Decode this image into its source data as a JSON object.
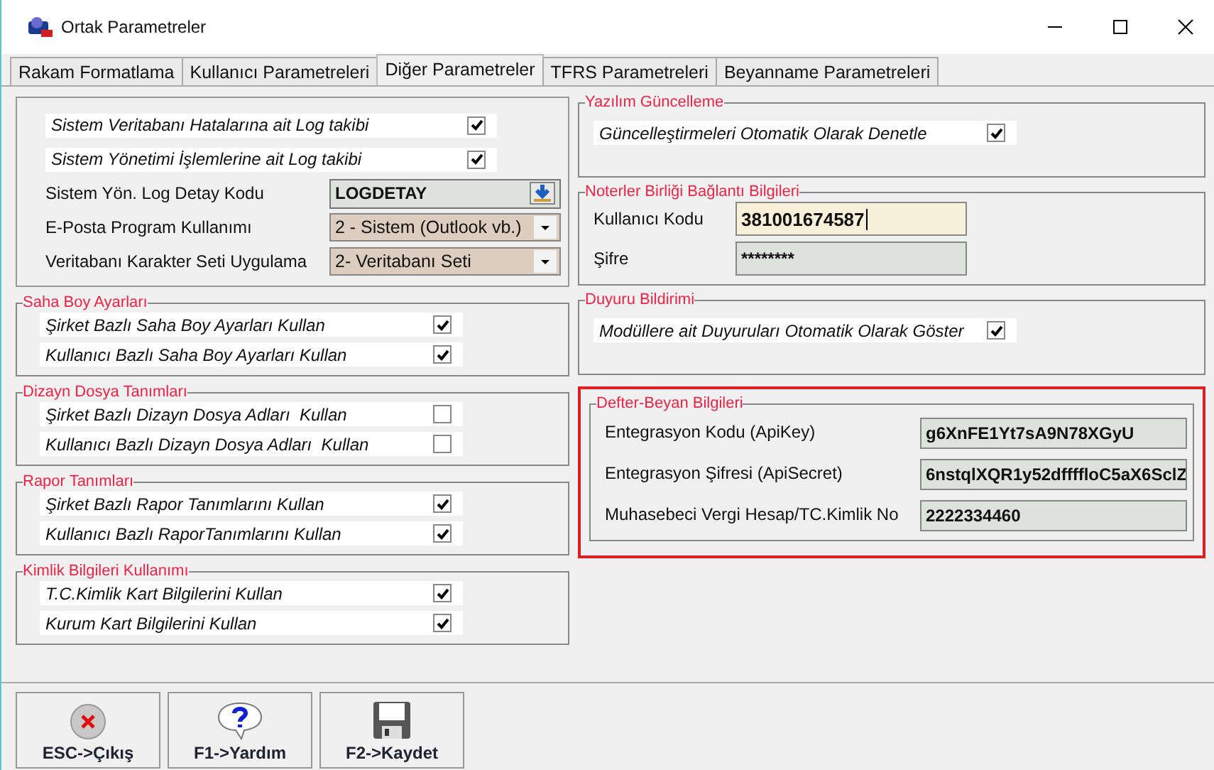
{
  "window": {
    "title": "Ortak Parametreler"
  },
  "tabs": [
    {
      "label": "Rakam Formatlama",
      "selected": false
    },
    {
      "label": "Kullanıcı Parametreleri",
      "selected": false
    },
    {
      "label": "Diğer Parametreler",
      "selected": true
    },
    {
      "label": "TFRS Parametreleri",
      "selected": false
    },
    {
      "label": "Beyanname Parametreleri",
      "selected": false
    }
  ],
  "general": [
    {
      "kind": "checkbox",
      "label": "Sistem Veritabanı Hatalarına ait Log takibi",
      "checked": true
    },
    {
      "kind": "checkbox",
      "label": "Sistem Yönetimi İşlemlerine ait Log takibi",
      "checked": true
    },
    {
      "kind": "lookup",
      "label": "Sistem Yön. Log Detay Kodu",
      "value": "LOGDETAY"
    },
    {
      "kind": "dropdown",
      "label": "E-Posta Program Kullanımı",
      "value": "2 - Sistem (Outlook vb.)"
    },
    {
      "kind": "dropdown",
      "label": "Veritabanı Karakter Seti Uygulama",
      "value": "2- Veritabanı Seti"
    }
  ],
  "left_groups": [
    {
      "title": "Saha Boy Ayarları",
      "items": [
        {
          "kind": "checkbox",
          "label": "Şirket Bazlı Saha Boy Ayarları Kullan",
          "checked": true
        },
        {
          "kind": "checkbox",
          "label": "Kullanıcı Bazlı Saha Boy Ayarları Kullan",
          "checked": true
        }
      ]
    },
    {
      "title": "Dizayn Dosya Tanımları",
      "items": [
        {
          "kind": "checkbox",
          "label": "Şirket Bazlı Dizayn Dosya Adları  Kullan",
          "checked": false
        },
        {
          "kind": "checkbox",
          "label": "Kullanıcı Bazlı Dizayn Dosya Adları  Kullan",
          "checked": false
        }
      ]
    },
    {
      "title": "Rapor Tanımları",
      "items": [
        {
          "kind": "checkbox",
          "label": "Şirket Bazlı Rapor Tanımlarını Kullan",
          "checked": true
        },
        {
          "kind": "checkbox",
          "label": "Kullanıcı Bazlı RaporTanımlarını Kullan",
          "checked": true
        }
      ]
    },
    {
      "title": "Kimlik Bilgileri Kullanımı",
      "items": [
        {
          "kind": "checkbox",
          "label": "T.C.Kimlik Kart Bilgilerini Kullan",
          "checked": true
        },
        {
          "kind": "checkbox",
          "label": "Kurum Kart Bilgilerini Kullan",
          "checked": true
        }
      ]
    }
  ],
  "right_groups": [
    {
      "title": "Yazılım Güncelleme",
      "highlighted": false,
      "items": [
        {
          "kind": "checkbox",
          "label": "Güncelleştirmeleri Otomatik Olarak Denetle",
          "checked": true
        }
      ]
    },
    {
      "title": "Noterler Birliği Bağlantı Bilgileri",
      "highlighted": false,
      "items": [
        {
          "kind": "field",
          "label": "Kullanıcı Kodu",
          "value": "381001674587",
          "focused": true
        },
        {
          "kind": "field",
          "label": "Şifre",
          "value": "********",
          "focused": false
        }
      ]
    },
    {
      "title": "Duyuru Bildirimi",
      "highlighted": false,
      "items": [
        {
          "kind": "checkbox",
          "label": "Modüllere ait Duyuruları Otomatik Olarak Göster",
          "checked": true
        }
      ]
    },
    {
      "title": "Defter-Beyan Bilgileri",
      "highlighted": true,
      "items": [
        {
          "kind": "field",
          "label": "Entegrasyon Kodu (ApiKey)",
          "value": "g6XnFE1Yt7sA9N78XGyU",
          "focused": false
        },
        {
          "kind": "field",
          "label": "Entegrasyon Şifresi (ApiSecret)",
          "value": "6nstqlXQR1y52dffffloC5aX6SclZ",
          "focused": false
        },
        {
          "kind": "field",
          "label": "Muhasebeci Vergi Hesap/TC.Kimlik No",
          "value": "2222334460",
          "focused": false
        }
      ]
    }
  ],
  "buttons": [
    {
      "kind": "exit",
      "label": "ESC->Çıkış"
    },
    {
      "kind": "help",
      "label": "F1->Yardım"
    },
    {
      "kind": "save",
      "label": "F2->Kaydet"
    }
  ]
}
